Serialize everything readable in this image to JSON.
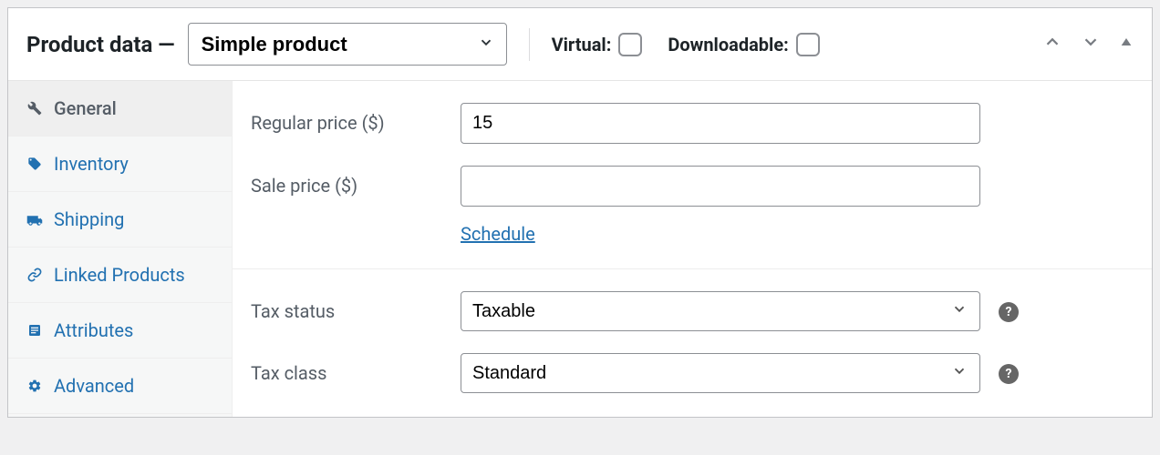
{
  "header": {
    "title": "Product data —",
    "product_type": "Simple product",
    "virtual_label": "Virtual:",
    "virtual_checked": false,
    "downloadable_label": "Downloadable:",
    "downloadable_checked": false
  },
  "tabs": {
    "general": "General",
    "inventory": "Inventory",
    "shipping": "Shipping",
    "linked": "Linked Products",
    "attributes": "Attributes",
    "advanced": "Advanced"
  },
  "form": {
    "regular_price_label": "Regular price ($)",
    "regular_price_value": "15",
    "sale_price_label": "Sale price ($)",
    "sale_price_value": "",
    "schedule_label": "Schedule",
    "tax_status_label": "Tax status",
    "tax_status_value": "Taxable",
    "tax_class_label": "Tax class",
    "tax_class_value": "Standard"
  }
}
